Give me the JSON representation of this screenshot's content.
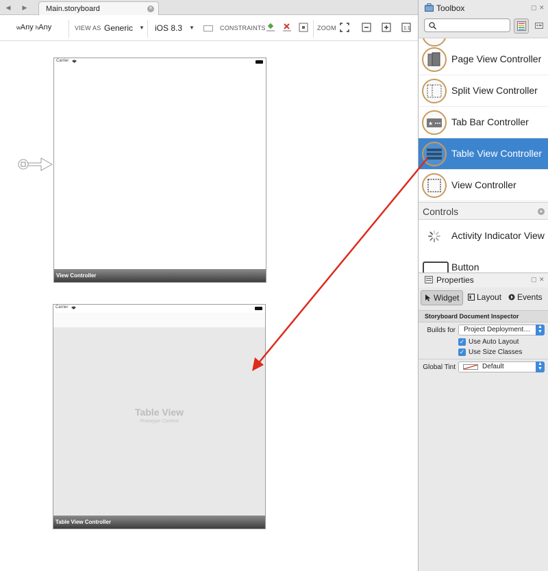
{
  "tab": {
    "title": "Main.storyboard"
  },
  "toolbar": {
    "size_class": "wAny hAny",
    "view_as_label": "VIEW AS",
    "view_as_value": "Generic",
    "ios_value": "iOS 8.3",
    "constraints_label": "CONSTRAINTS",
    "zoom_label": "ZOOM"
  },
  "canvas": {
    "scene1": {
      "carrier": "Carrier",
      "footer": "View Controller"
    },
    "scene2": {
      "carrier": "Carrier",
      "footer": "Table View Controller",
      "table_title": "Table View",
      "table_subtitle": "Prototype Content"
    },
    "annotation_arrow_color": "#dd2a1c"
  },
  "toolbox": {
    "title": "Toolbox",
    "search_placeholder": "",
    "items": [
      {
        "label": "Page View Controller",
        "icon": "page-view-controller-icon"
      },
      {
        "label": "Split View Controller",
        "icon": "split-view-controller-icon"
      },
      {
        "label": "Tab Bar Controller",
        "icon": "tab-bar-controller-icon"
      },
      {
        "label": "Table View Controller",
        "icon": "table-view-controller-icon",
        "selected": true
      },
      {
        "label": "View Controller",
        "icon": "view-controller-icon"
      }
    ],
    "controls_header": "Controls",
    "controls": [
      {
        "label": "Activity Indicator View",
        "icon": "activity-indicator-icon"
      },
      {
        "label": "Button",
        "icon": "button-icon"
      }
    ],
    "selection_color": "#3d84cf"
  },
  "properties": {
    "title": "Properties",
    "tabs": [
      {
        "label": "Widget",
        "active": true
      },
      {
        "label": "Layout"
      },
      {
        "label": "Events"
      }
    ],
    "section_title": "Storyboard Document Inspector",
    "builds_for_label": "Builds for",
    "builds_for_value": "Project Deployment…",
    "use_auto_layout": "Use Auto Layout",
    "use_size_classes": "Use Size Classes",
    "global_tint_label": "Global Tint",
    "global_tint_value": "Default"
  }
}
